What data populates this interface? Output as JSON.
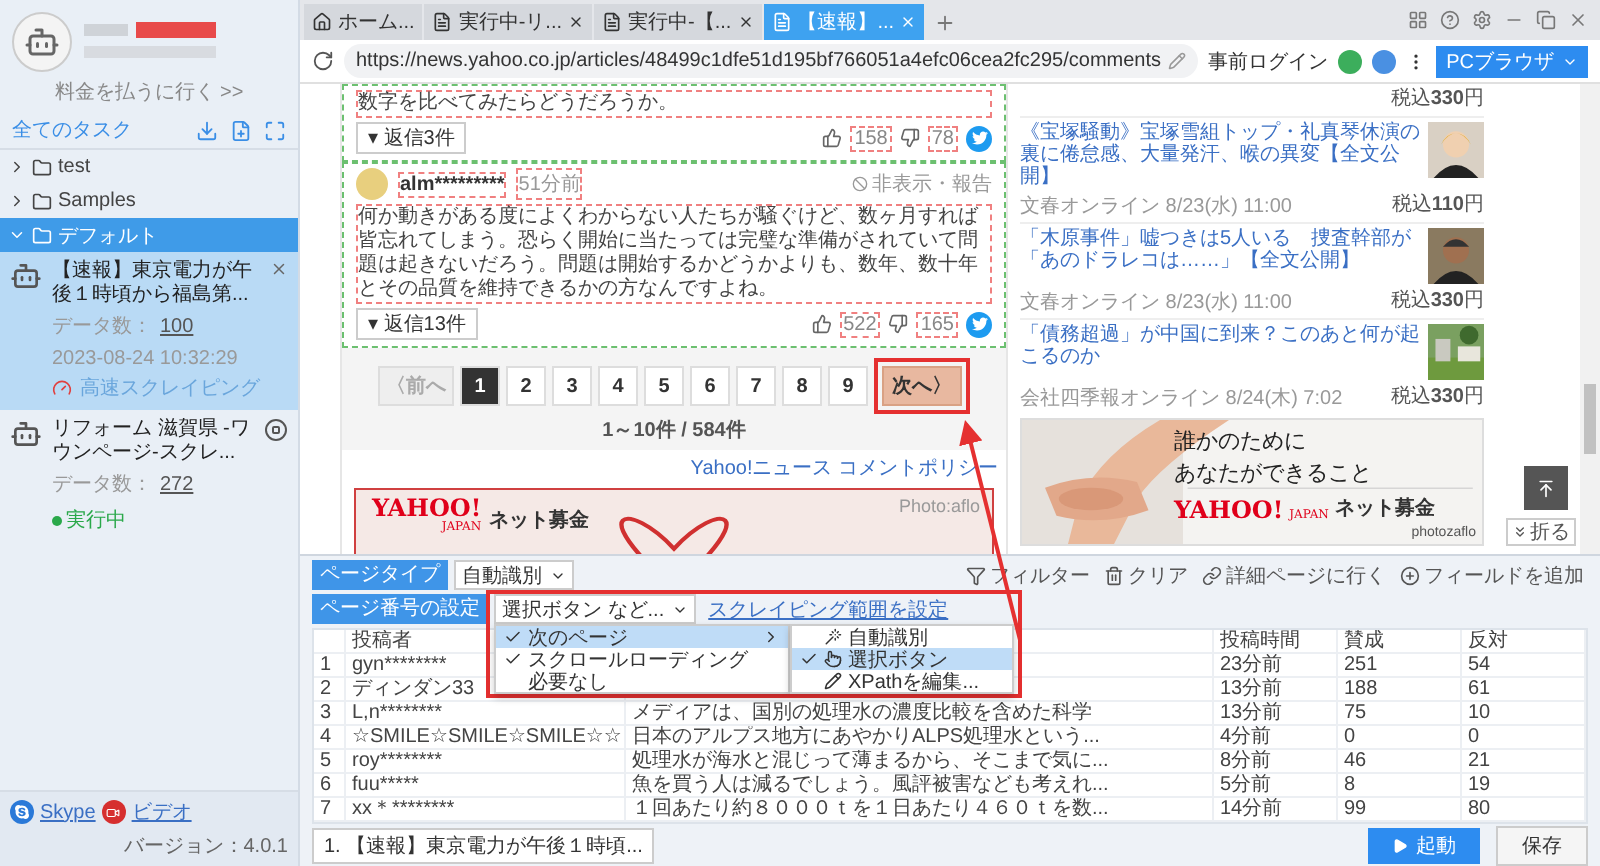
{
  "sidebar": {
    "billing_link": "料金を払うに行く >>",
    "section_title": "全てのタスク",
    "folders": [
      {
        "name": "test",
        "expanded": false,
        "selected": false
      },
      {
        "name": "Samples",
        "expanded": false,
        "selected": false
      },
      {
        "name": "デフォルト",
        "expanded": true,
        "selected": true
      }
    ],
    "tasks": [
      {
        "kind": "done",
        "title": "【速報】東京電力が午後１時頃から福島第...",
        "data_label": "データ数：",
        "count": "100",
        "time": "2023-08-24 10:32:29",
        "mode": "高速スクレイピング",
        "selected": true
      },
      {
        "kind": "running",
        "title": "リフォーム 滋賀県 -ワウンページ-スクレ...",
        "data_label": "データ数：",
        "count": "272",
        "status": "実行中",
        "selected": false
      }
    ],
    "footer": {
      "skype": "Skype",
      "video": "ビデオ",
      "version": "バージョン：4.0.1"
    }
  },
  "browser": {
    "tabs": [
      {
        "kind": "home",
        "label": "ホーム...",
        "closable": false,
        "selected": false
      },
      {
        "kind": "page",
        "label": "実行中-リ...",
        "closable": true,
        "selected": false
      },
      {
        "kind": "page",
        "label": "実行中-【...",
        "closable": true,
        "selected": false
      },
      {
        "kind": "page",
        "label": "【速報】...",
        "closable": true,
        "selected": true
      }
    ],
    "url": "https://news.yahoo.co.jp/articles/48499c1dfe51d195bf766051a4efc06cea2fc295/comments",
    "login": "事前ログイン",
    "mode_button": "PCブラウザ"
  },
  "page": {
    "comments": [
      {
        "kind": "partial",
        "text": "数字を比べてみたらどうだろうか。",
        "replies": "▾ 返信3件",
        "likes": "158",
        "dislikes": "78"
      },
      {
        "kind": "full",
        "user": "alm*********",
        "age": "51分前",
        "report": "非表示・報告",
        "text": "何か動きがある度によくわからない人たちが騒ぐけど、数ヶ月すれば皆忘れてしまう。恐らく開始に当たっては完璧な準備がされていて問題は起きないだろう。問題は開始するかどうかよりも、数年、数十年とその品質を維持できるかの方なんですよね。",
        "replies": "▾ 返信13件",
        "likes": "522",
        "dislikes": "165"
      }
    ],
    "pagination": {
      "prev": "〈前へ",
      "prev_disabled": true,
      "pages": [
        {
          "label": "1",
          "selected": true
        },
        {
          "label": "2",
          "selected": false
        },
        {
          "label": "3",
          "selected": false
        },
        {
          "label": "4",
          "selected": false
        },
        {
          "label": "5",
          "selected": false
        },
        {
          "label": "6",
          "selected": false
        },
        {
          "label": "7",
          "selected": false
        },
        {
          "label": "8",
          "selected": false
        },
        {
          "label": "9",
          "selected": false
        }
      ],
      "next": "次へ〉",
      "summary": "1～10件 / 584件"
    },
    "policy_link": "Yahoo!ニュース コメントポリシー",
    "ad": {
      "logo": "YAHOO!",
      "logo_sub": "JAPAN",
      "brand": "ネット募金",
      "credit": "Photo:aflo"
    },
    "side_news": {
      "top_price": "税込**330**円",
      "items": [
        {
          "title": "《宝塚騒動》宝塚雪組トップ・礼真琴休演の裏に倦怠感、大量発汗、喉の異変【全文公開】",
          "source": "文春オンライン 8/23(水) 11:00",
          "price": "税込**110**円"
        },
        {
          "title": "「木原事件」嘘つきは5人いる　捜査幹部が「あのドラレコは……」【全文公開】",
          "source": "文春オンライン 8/23(水) 11:00",
          "price": "税込**330**円"
        },
        {
          "title": "「債務超過」が中国に到来？このあと何が起こるのか",
          "source": "会社四季報オンライン 8/24(木) 7:02",
          "price": "税込**330**円"
        }
      ]
    },
    "side_ad": {
      "lines": [
        "誰かのために",
        "あなたができること"
      ],
      "logo": "YAHOO!",
      "logo_sub": "JAPAN",
      "brand": "ネット募金",
      "credit": "photozaflo"
    },
    "fold": "折る"
  },
  "panel": {
    "page_type_label": "ページタイプ",
    "page_type_value": "自動識別",
    "paging_label": "ページ番号の設定",
    "paging_value": "選択ボタン など...",
    "range_link": "スクレイピング範囲を設定",
    "actions": [
      {
        "kind": "filter",
        "label": "フィルター"
      },
      {
        "kind": "clear",
        "label": "クリア"
      },
      {
        "kind": "detail",
        "label": "詳細ページに行く"
      },
      {
        "kind": "add",
        "label": "フィールドを追加"
      }
    ],
    "menu": [
      {
        "label": "次のページ",
        "checked": true,
        "selected": true,
        "submenu": true
      },
      {
        "label": "スクロールローディング",
        "checked": true,
        "selected": false,
        "submenu": false
      },
      {
        "label": "必要なし",
        "checked": false,
        "selected": false,
        "submenu": false
      }
    ],
    "submenu": [
      {
        "kind": "auto",
        "label": "自動識別",
        "checked": false,
        "selected": false
      },
      {
        "kind": "click",
        "label": "選択ボタン",
        "checked": true,
        "selected": true
      },
      {
        "kind": "xpath",
        "label": "XPathを編集...",
        "checked": false,
        "selected": false
      }
    ],
    "table": {
      "columns": [
        "投稿者",
        "投稿時間",
        "賛成",
        "反対"
      ],
      "rows": [
        {
          "index": "1",
          "author": "gyn********",
          "time": "23分前",
          "agree": "251",
          "disagree": "54"
        },
        {
          "index": "2",
          "author": "ディンダン33",
          "time": "13分前",
          "agree": "188",
          "disagree": "61"
        },
        {
          "index": "3",
          "author": "L,n********",
          "comment": "メディアは、国別の処理水の濃度比較を含めた科学",
          "time": "13分前",
          "agree": "75",
          "disagree": "10"
        },
        {
          "index": "4",
          "author": "☆SMILE☆SMILE☆SMILE☆☆",
          "comment": "日本のアルプス地方にあやかりALPS処理水という...",
          "time": "4分前",
          "agree": "0",
          "disagree": "0"
        },
        {
          "index": "5",
          "author": "roy********",
          "comment": "処理水が海水と混じって薄まるから、そこまで気に...",
          "time": "8分前",
          "agree": "46",
          "disagree": "21"
        },
        {
          "index": "6",
          "author": "fuu*****",
          "comment": "魚を買う人は減るでしょう。風評被害なども考えれ...",
          "time": "5分前",
          "agree": "8",
          "disagree": "19"
        },
        {
          "index": "7",
          "author": "xx＊********",
          "comment": "１回あたり約８０００ｔを１日あたり４６０ｔを数...",
          "time": "14分前",
          "agree": "99",
          "disagree": "80"
        }
      ]
    },
    "task_tab": "1. 【速報】東京電力が午後１時頃...",
    "start_button": "起動",
    "save_button": "保存"
  }
}
